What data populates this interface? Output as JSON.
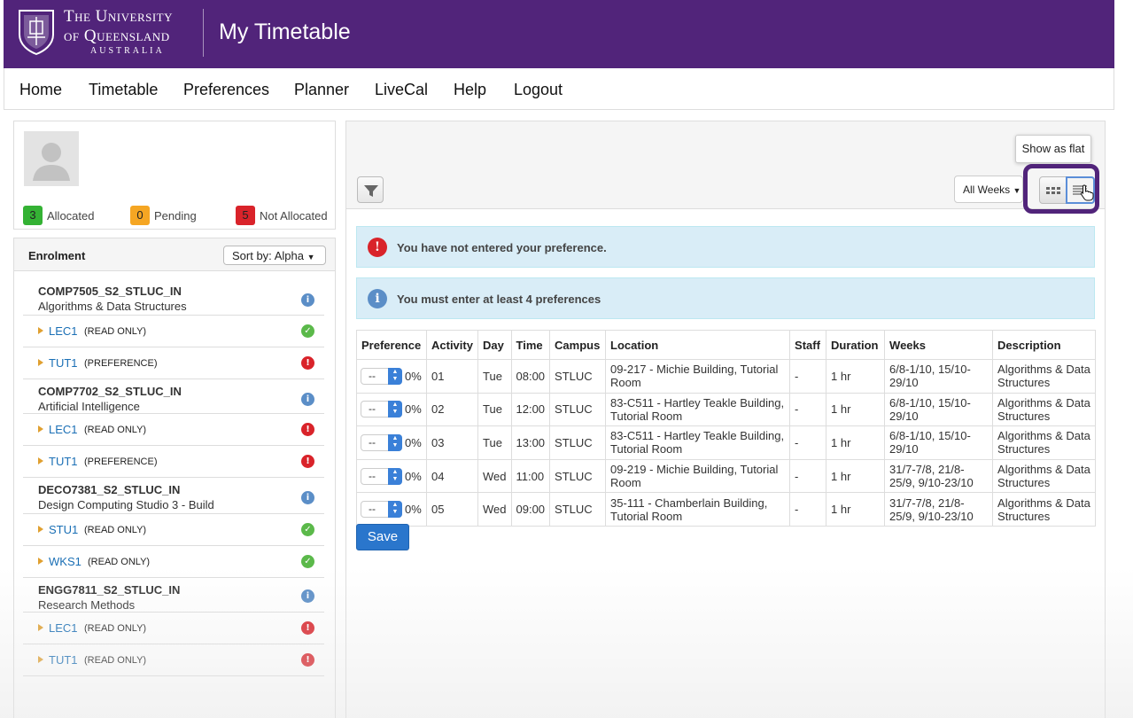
{
  "header": {
    "university_line1": "The University",
    "university_line2": "of Queensland",
    "university_line3": "AUSTRALIA",
    "app_title": "My Timetable",
    "brand_color": "#51247a"
  },
  "nav": {
    "items": [
      "Home",
      "Timetable",
      "Preferences",
      "Planner",
      "LiveCal",
      "Help",
      "Logout"
    ]
  },
  "profile": {
    "allocated_count": "3",
    "allocated_label": "Allocated",
    "pending_count": "0",
    "pending_label": "Pending",
    "not_allocated_count": "5",
    "not_allocated_label": "Not Allocated"
  },
  "enrolment": {
    "title": "Enrolment",
    "sort_label": "Sort by: Alpha",
    "courses": [
      {
        "code": "COMP7505_S2_STLUC_IN",
        "name": "Algorithms & Data Structures",
        "activities": [
          {
            "name": "LEC1",
            "mode": "(READ ONLY)",
            "status": "ok"
          },
          {
            "name": "TUT1",
            "mode": "(PREFERENCE)",
            "status": "error"
          }
        ]
      },
      {
        "code": "COMP7702_S2_STLUC_IN",
        "name": "Artificial Intelligence",
        "activities": [
          {
            "name": "LEC1",
            "mode": "(READ ONLY)",
            "status": "error"
          },
          {
            "name": "TUT1",
            "mode": "(PREFERENCE)",
            "status": "error"
          }
        ]
      },
      {
        "code": "DECO7381_S2_STLUC_IN",
        "name": "Design Computing Studio 3 - Build",
        "activities": [
          {
            "name": "STU1",
            "mode": "(READ ONLY)",
            "status": "ok"
          },
          {
            "name": "WKS1",
            "mode": "(READ ONLY)",
            "status": "ok"
          }
        ]
      },
      {
        "code": "ENGG7811_S2_STLUC_IN",
        "name": "Research Methods",
        "activities": [
          {
            "name": "LEC1",
            "mode": "(READ ONLY)",
            "status": "error"
          },
          {
            "name": "TUT1",
            "mode": "(READ ONLY)",
            "status": "error"
          }
        ]
      }
    ]
  },
  "toolbar": {
    "weeks_label": "All Weeks",
    "tooltip": "Show as flat"
  },
  "alerts": {
    "error_text": "You have not entered your preference.",
    "info_text": "You must enter at least 4 preferences"
  },
  "table": {
    "headers": [
      "Preference",
      "Activity",
      "Day",
      "Time",
      "Campus",
      "Location",
      "Staff",
      "Duration",
      "Weeks",
      "Description"
    ],
    "rows": [
      {
        "pref": "--",
        "pct": "0%",
        "activity": "01",
        "day": "Tue",
        "time": "08:00",
        "campus": "STLUC",
        "location": "09-217 - Michie Building, Tutorial Room",
        "staff": "-",
        "duration": "1 hr",
        "weeks": "6/8-1/10, 15/10-29/10",
        "description": "Algorithms & Data Structures"
      },
      {
        "pref": "--",
        "pct": "0%",
        "activity": "02",
        "day": "Tue",
        "time": "12:00",
        "campus": "STLUC",
        "location": "83-C511 - Hartley Teakle Building, Tutorial Room",
        "staff": "-",
        "duration": "1 hr",
        "weeks": "6/8-1/10, 15/10-29/10",
        "description": "Algorithms & Data Structures"
      },
      {
        "pref": "--",
        "pct": "0%",
        "activity": "03",
        "day": "Tue",
        "time": "13:00",
        "campus": "STLUC",
        "location": "83-C511 - Hartley Teakle Building, Tutorial Room",
        "staff": "-",
        "duration": "1 hr",
        "weeks": "6/8-1/10, 15/10-29/10",
        "description": "Algorithms & Data Structures"
      },
      {
        "pref": "--",
        "pct": "0%",
        "activity": "04",
        "day": "Wed",
        "time": "11:00",
        "campus": "STLUC",
        "location": "09-219 - Michie Building, Tutorial Room",
        "staff": "-",
        "duration": "1 hr",
        "weeks": "31/7-7/8, 21/8-25/9, 9/10-23/10",
        "description": "Algorithms & Data Structures"
      },
      {
        "pref": "--",
        "pct": "0%",
        "activity": "05",
        "day": "Wed",
        "time": "09:00",
        "campus": "STLUC",
        "location": "35-111 - Chamberlain Building, Tutorial Room",
        "staff": "-",
        "duration": "1 hr",
        "weeks": "31/7-7/8, 21/8-25/9, 9/10-23/10",
        "description": "Algorithms & Data Structures"
      }
    ]
  },
  "save_label": "Save"
}
